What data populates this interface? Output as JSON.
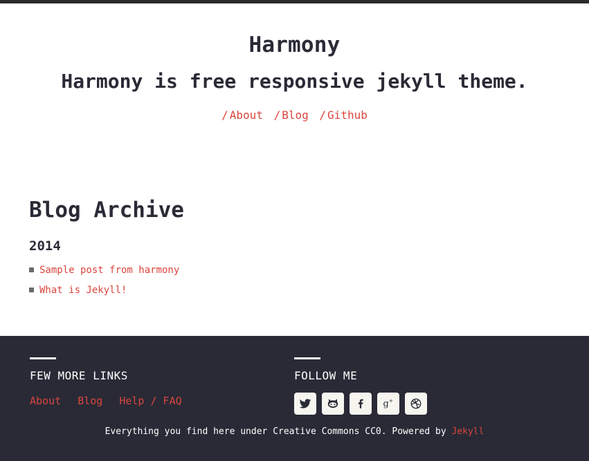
{
  "header": {
    "title": "Harmony",
    "description": "Harmony is free responsive jekyll theme.",
    "nav": [
      {
        "label": "About"
      },
      {
        "label": "Blog"
      },
      {
        "label": "Github"
      }
    ],
    "nav_separator": "/"
  },
  "main": {
    "title": "Blog Archive",
    "years": [
      {
        "year": "2014",
        "posts": [
          {
            "title": "Sample post from harmony"
          },
          {
            "title": "What is Jekyll!"
          }
        ]
      }
    ]
  },
  "footer": {
    "links_title": "FEW MORE LINKS",
    "links": [
      {
        "label": "About"
      },
      {
        "label": "Blog"
      },
      {
        "label": "Help / FAQ"
      }
    ],
    "follow_title": "FOLLOW ME",
    "socials": [
      {
        "name": "twitter",
        "icon": "twitter-icon"
      },
      {
        "name": "github",
        "icon": "github-icon"
      },
      {
        "name": "facebook",
        "icon": "facebook-icon"
      },
      {
        "name": "google-plus",
        "icon": "google-plus-icon"
      },
      {
        "name": "dribbble",
        "icon": "dribbble-icon"
      }
    ],
    "copyright_text": "Everything you find here under Creative Commons CC0. Powered by ",
    "copyright_link": "Jekyll"
  },
  "colors": {
    "accent": "#d9453d",
    "text": "#2a2b36",
    "footer_bg": "#292a36",
    "top_bar": "#2a2b2e",
    "social_bg": "#f7f5f0"
  }
}
